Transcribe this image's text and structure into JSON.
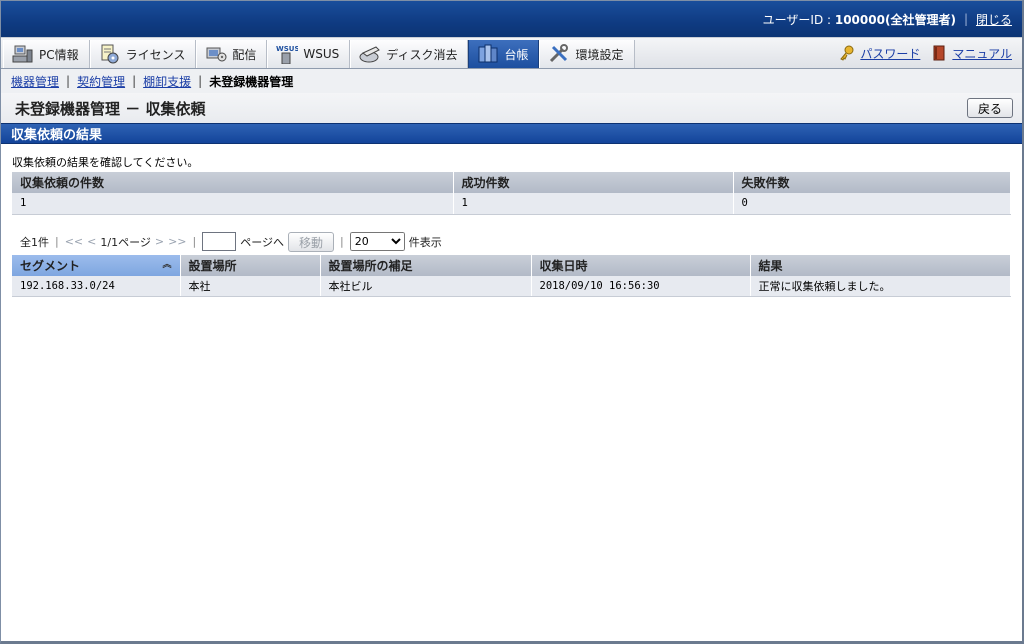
{
  "header": {
    "user_label": "ユーザーID : ",
    "user_value": "100000(全社管理者)",
    "close_link": "閉じる"
  },
  "tabs": [
    {
      "label": "PC情報",
      "icon": "pc-icon"
    },
    {
      "label": "ライセンス",
      "icon": "license-icon"
    },
    {
      "label": "配信",
      "icon": "distribution-icon"
    },
    {
      "label": "WSUS",
      "icon": "wsus-icon",
      "icon_text": "WSUS"
    },
    {
      "label": "ディスク消去",
      "icon": "disk-erase-icon"
    },
    {
      "label": "台帳",
      "icon": "ledger-icon",
      "active": true
    },
    {
      "label": "環境設定",
      "icon": "settings-icon"
    }
  ],
  "right_links": {
    "password": "パスワード",
    "manual": "マニュアル"
  },
  "breadcrumb": {
    "items": [
      "機器管理",
      "契約管理",
      "棚卸支援"
    ],
    "current": "未登録機器管理"
  },
  "page": {
    "title": "未登録機器管理 － 収集依頼",
    "back_button": "戻る"
  },
  "section": {
    "title": "収集依頼の結果",
    "message": "収集依頼の結果を確認してください。"
  },
  "summary_table": {
    "headers": [
      "収集依頼の件数",
      "成功件数",
      "失敗件数"
    ],
    "row": [
      "1",
      "1",
      "0"
    ]
  },
  "pager": {
    "total": "全1件",
    "first": "<<",
    "prev": "<",
    "page_info": "1/1ページ",
    "next": ">",
    "last": ">>",
    "page_input": "",
    "page_suffix": "ページへ",
    "move_button": "移動",
    "per_page": "20",
    "per_page_suffix": "件表示"
  },
  "result_table": {
    "headers": [
      "セグメント",
      "設置場所",
      "設置場所の補足",
      "収集日時",
      "結果"
    ],
    "rows": [
      [
        "192.168.33.0/24",
        "本社",
        "本社ビル",
        "2018/09/10 16:56:30",
        "正常に収集依頼しました。"
      ]
    ]
  },
  "colors": {
    "header_blue": "#0f3b82",
    "tab_active": "#1d4f9f",
    "section_blue": "#13449a",
    "link": "#1b3ea6"
  }
}
